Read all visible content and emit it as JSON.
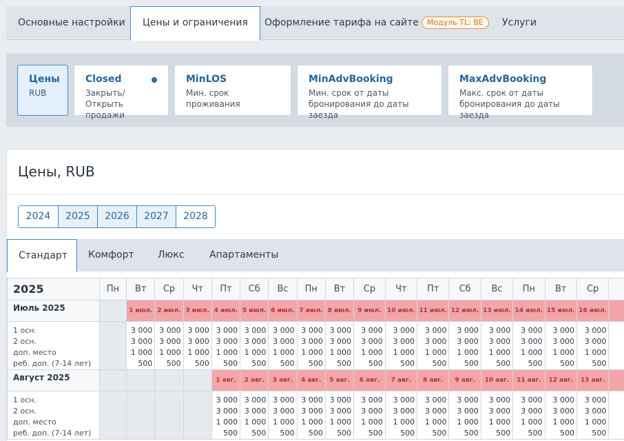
{
  "top_tabs": [
    {
      "label": "Основные настройки",
      "badge": ""
    },
    {
      "label": "Цены и ограничения",
      "badge": ""
    },
    {
      "label": "Оформление тарифа на сайте",
      "badge": "Модуль TL: BE"
    },
    {
      "label": "Услуги",
      "badge": ""
    }
  ],
  "cards": [
    {
      "title": "Цены",
      "desc1": "RUB",
      "desc2": ""
    },
    {
      "title": "Closed",
      "desc1": "Закрыть/Открыть",
      "desc2": "продажи"
    },
    {
      "title": "MinLOS",
      "desc1": "Мин. срок проживания",
      "desc2": ""
    },
    {
      "title": "MinAdvBooking",
      "desc1": "Мин. срок от даты",
      "desc2": "бронирования до даты заезда"
    },
    {
      "title": "MaxAdvBooking",
      "desc1": "Макс. срок от даты",
      "desc2": "бронирования до даты заезда"
    }
  ],
  "section_title": "Цены, RUB",
  "years": [
    "2024",
    "2025",
    "2026",
    "2027",
    "2028"
  ],
  "room_tabs": [
    "Стандарт",
    "Комфорт",
    "Люкс",
    "Апартаменты"
  ],
  "grid": {
    "year": "2025",
    "weekdays": [
      "Пн",
      "Вт",
      "Ср",
      "Чт",
      "Пт",
      "Сб",
      "Вс",
      "Пн",
      "Вт",
      "Ср",
      "Чт",
      "Пт",
      "Сб",
      "Вс",
      "Пн",
      "Вт",
      "Ср",
      ""
    ],
    "row_labels": [
      "1 осн.",
      "2 осн.",
      "доп. место",
      "реб. доп. (7-14 лет)"
    ],
    "months": [
      {
        "name": "Июль 2025",
        "offset": 1,
        "dates": [
          "1 июл.",
          "2 июл.",
          "3 июл.",
          "4 июл.",
          "5 июл.",
          "6 июл.",
          "7 июл.",
          "8 июл.",
          "9 июл.",
          "10 июл.",
          "11 июл.",
          "12 июл.",
          "13 июл.",
          "14 июл.",
          "15 июл.",
          "16 июл.",
          ""
        ]
      },
      {
        "name": "Август 2025",
        "offset": 4,
        "dates": [
          "1 авг.",
          "2 авг.",
          "3 авг.",
          "4 авг.",
          "5 авг.",
          "6 авг.",
          "7 авг.",
          "8 авг.",
          "9 авг.",
          "10 авг.",
          "11 авг.",
          "12 авг.",
          "13 авг.",
          ""
        ]
      }
    ],
    "prices": [
      "3 000",
      "3 000",
      "1 000",
      "500"
    ]
  }
}
